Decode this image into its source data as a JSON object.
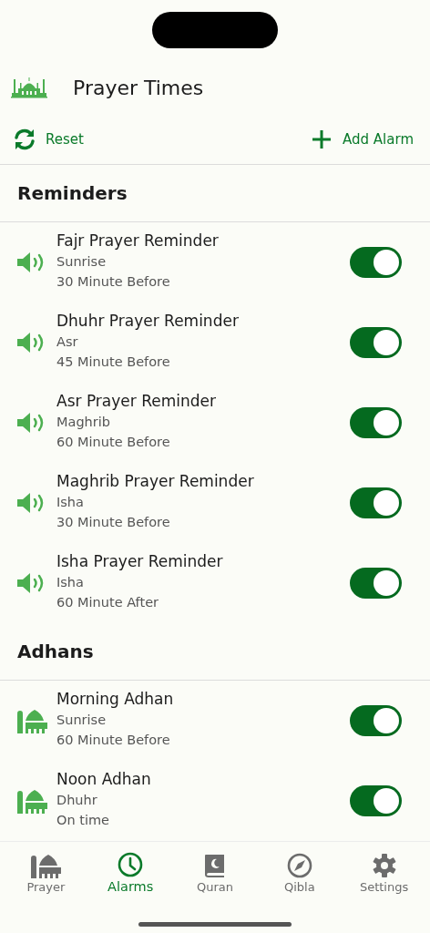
{
  "header": {
    "title": "Prayer Times"
  },
  "toolbar": {
    "reset": "Reset",
    "add": "Add Alarm"
  },
  "sections": [
    {
      "title": "Reminders",
      "items": [
        {
          "kind": "speaker",
          "title": "Fajr Prayer Reminder",
          "prayer": "Sunrise",
          "offset": "30 Minute Before",
          "on": true
        },
        {
          "kind": "speaker",
          "title": "Dhuhr Prayer Reminder",
          "prayer": "Asr",
          "offset": "45 Minute Before",
          "on": true
        },
        {
          "kind": "speaker",
          "title": "Asr Prayer Reminder",
          "prayer": "Maghrib",
          "offset": "60 Minute Before",
          "on": true
        },
        {
          "kind": "speaker",
          "title": "Maghrib Prayer Reminder",
          "prayer": "Isha",
          "offset": "30 Minute Before",
          "on": true
        },
        {
          "kind": "speaker",
          "title": "Isha Prayer Reminder",
          "prayer": "Isha",
          "offset": "60 Minute After",
          "on": true
        }
      ]
    },
    {
      "title": "Adhans",
      "items": [
        {
          "kind": "mosque",
          "title": "Morning Adhan",
          "prayer": "Sunrise",
          "offset": "60 Minute Before",
          "on": true
        },
        {
          "kind": "mosque",
          "title": "Noon Adhan",
          "prayer": "Dhuhr",
          "offset": "On time",
          "on": true
        }
      ]
    }
  ],
  "tabs": [
    {
      "kind": "mosque",
      "label": "Prayer",
      "selected": false
    },
    {
      "kind": "clock",
      "label": "Alarms",
      "selected": true
    },
    {
      "kind": "book",
      "label": "Quran",
      "selected": false
    },
    {
      "kind": "compass",
      "label": "Qibla",
      "selected": false
    },
    {
      "kind": "gear",
      "label": "Settings",
      "selected": false
    }
  ]
}
